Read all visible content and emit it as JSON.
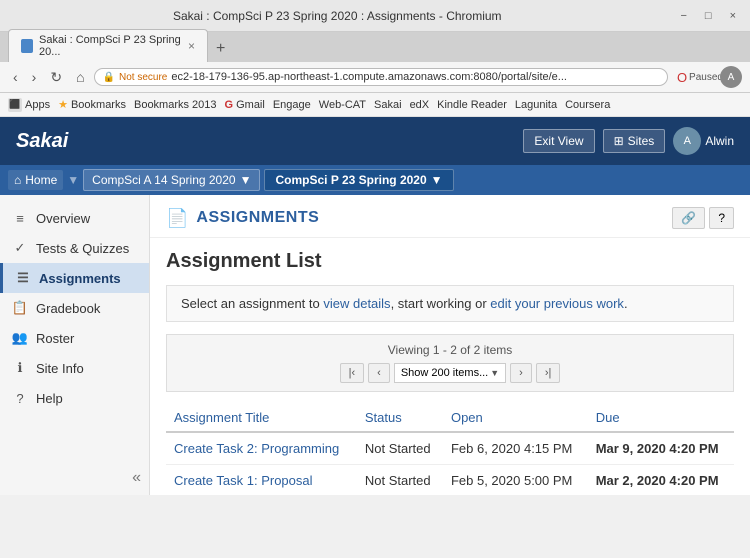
{
  "browser": {
    "titlebar": {
      "title": "Sakai : CompSci P 23 Spring 2020 : Assignments - Chromium"
    },
    "tab": {
      "title": "Sakai : CompSci P 23 Spring 20...",
      "close_label": "×"
    },
    "new_tab_label": "+",
    "toolbar": {
      "back_label": "‹",
      "forward_label": "›",
      "reload_label": "↻",
      "home_label": "⌂",
      "address": "ec2-18-179-136-95.ap-northeast-1.compute.amazonaws.com:8080/portal/site/e...",
      "security_label": "Not secure",
      "paused_label": "Paused"
    },
    "bookmarks": [
      {
        "label": "Apps"
      },
      {
        "label": "Bookmarks"
      },
      {
        "label": "Bookmarks 2013"
      },
      {
        "label": "Gmail"
      },
      {
        "label": "Engage"
      },
      {
        "label": "Web-CAT"
      },
      {
        "label": "Sakai"
      },
      {
        "label": "edX"
      },
      {
        "label": "Kindle Reader"
      },
      {
        "label": "Lagunita"
      },
      {
        "label": "Coursera"
      }
    ]
  },
  "sakai": {
    "logo": "Sakai",
    "header_buttons": {
      "exit_view": "Exit View",
      "sites": "Sites",
      "user": "Alwin"
    },
    "breadcrumb": {
      "home": "Home",
      "site1": "CompSci A 14 Spring 2020",
      "site2": "CompSci P 23 Spring 2020"
    },
    "sidebar": {
      "items": [
        {
          "id": "overview",
          "label": "Overview",
          "icon": "≡"
        },
        {
          "id": "tests-quizzes",
          "label": "Tests & Quizzes",
          "icon": "✓"
        },
        {
          "id": "assignments",
          "label": "Assignments",
          "icon": "☰"
        },
        {
          "id": "gradebook",
          "label": "Gradebook",
          "icon": "📋"
        },
        {
          "id": "roster",
          "label": "Roster",
          "icon": "👥"
        },
        {
          "id": "site-info",
          "label": "Site Info",
          "icon": "ℹ"
        },
        {
          "id": "help",
          "label": "Help",
          "icon": "?"
        }
      ],
      "collapse_label": "«"
    },
    "page": {
      "icon": "📄",
      "title": "ASSIGNMENTS",
      "action_link_label": "🔗",
      "action_help_label": "?"
    },
    "content": {
      "list_title": "Assignment List",
      "info_message": "Select an assignment to view details, start working or edit your previous work.",
      "info_link1": "view details",
      "info_link2": "edit your previous work",
      "pagination": {
        "info": "Viewing 1 - 2 of 2 items",
        "first_label": "|‹",
        "prev_label": "‹",
        "size_label": "Show 200 items...",
        "next_label": "›",
        "last_label": "›|"
      },
      "table": {
        "headers": [
          {
            "id": "title",
            "label": "Assignment Title"
          },
          {
            "id": "status",
            "label": "Status"
          },
          {
            "id": "open",
            "label": "Open"
          },
          {
            "id": "due",
            "label": "Due"
          }
        ],
        "rows": [
          {
            "title": "Create Task 2: Programming",
            "status": "Not Started",
            "open": "Feb 6, 2020 4:15 PM",
            "due": "Mar 9, 2020 4:20 PM",
            "due_color": "red"
          },
          {
            "title": "Create Task 1: Proposal",
            "status": "Not Started",
            "open": "Feb 5, 2020 5:00 PM",
            "due": "Mar 2, 2020 4:20 PM",
            "due_color": "red"
          }
        ]
      }
    }
  }
}
